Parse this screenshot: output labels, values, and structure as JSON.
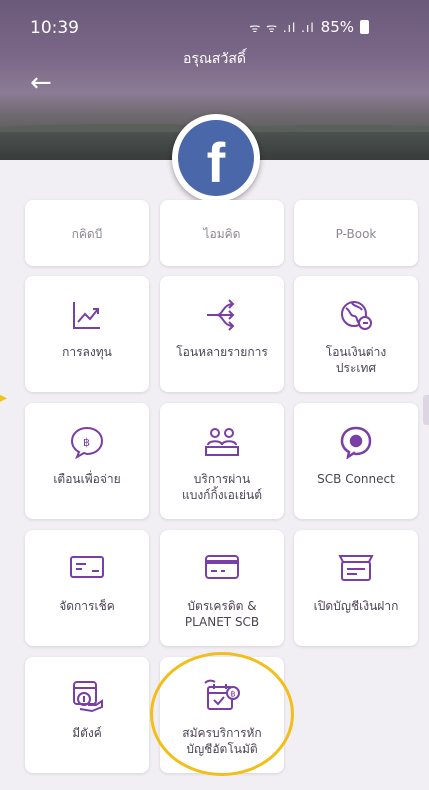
{
  "status_bar": {
    "time": "10:39",
    "signal": "ᯤ ᯤ .ıl .ıl",
    "battery": "85%"
  },
  "header": {
    "greeting": "อรุณสวัสดิ์",
    "back_icon": "back-arrow-icon",
    "logo_icon": "facebook-icon",
    "logo_glyph": "f"
  },
  "partial_row": [
    "กคิดบี",
    "ไอมคิด",
    "P-Book"
  ],
  "tiles": [
    {
      "label": "การลงทุน",
      "icon": "investment-chart-icon"
    },
    {
      "label": "โอนหลายรายการ",
      "icon": "multi-transfer-icon"
    },
    {
      "label": "โอนเงินต่าง\nประเทศ",
      "icon": "international-transfer-icon"
    },
    {
      "label": "เตือนเพื่อจ่าย",
      "icon": "payment-reminder-icon"
    },
    {
      "label": "บริการผ่าน\nแบงก์กิ้งเอเย่นต์",
      "icon": "banking-agent-icon"
    },
    {
      "label": "SCB Connect",
      "icon": "scb-connect-icon"
    },
    {
      "label": "จัดการเช็ค",
      "icon": "cheque-icon"
    },
    {
      "label": "บัตรเครดิต &\nPLANET SCB",
      "icon": "credit-card-icon"
    },
    {
      "label": "เปิดบัญชีเงินฝาก",
      "icon": "open-account-icon"
    },
    {
      "label": "มีตังค์",
      "icon": "wallet-icon"
    },
    {
      "label": "สมัครบริการหัก\nบัญชีอัตโนมัติ",
      "icon": "auto-debit-icon"
    }
  ],
  "colors": {
    "accent": "#7a3fa7",
    "highlight": "#f2be1a",
    "facebook": "#4967a9"
  }
}
